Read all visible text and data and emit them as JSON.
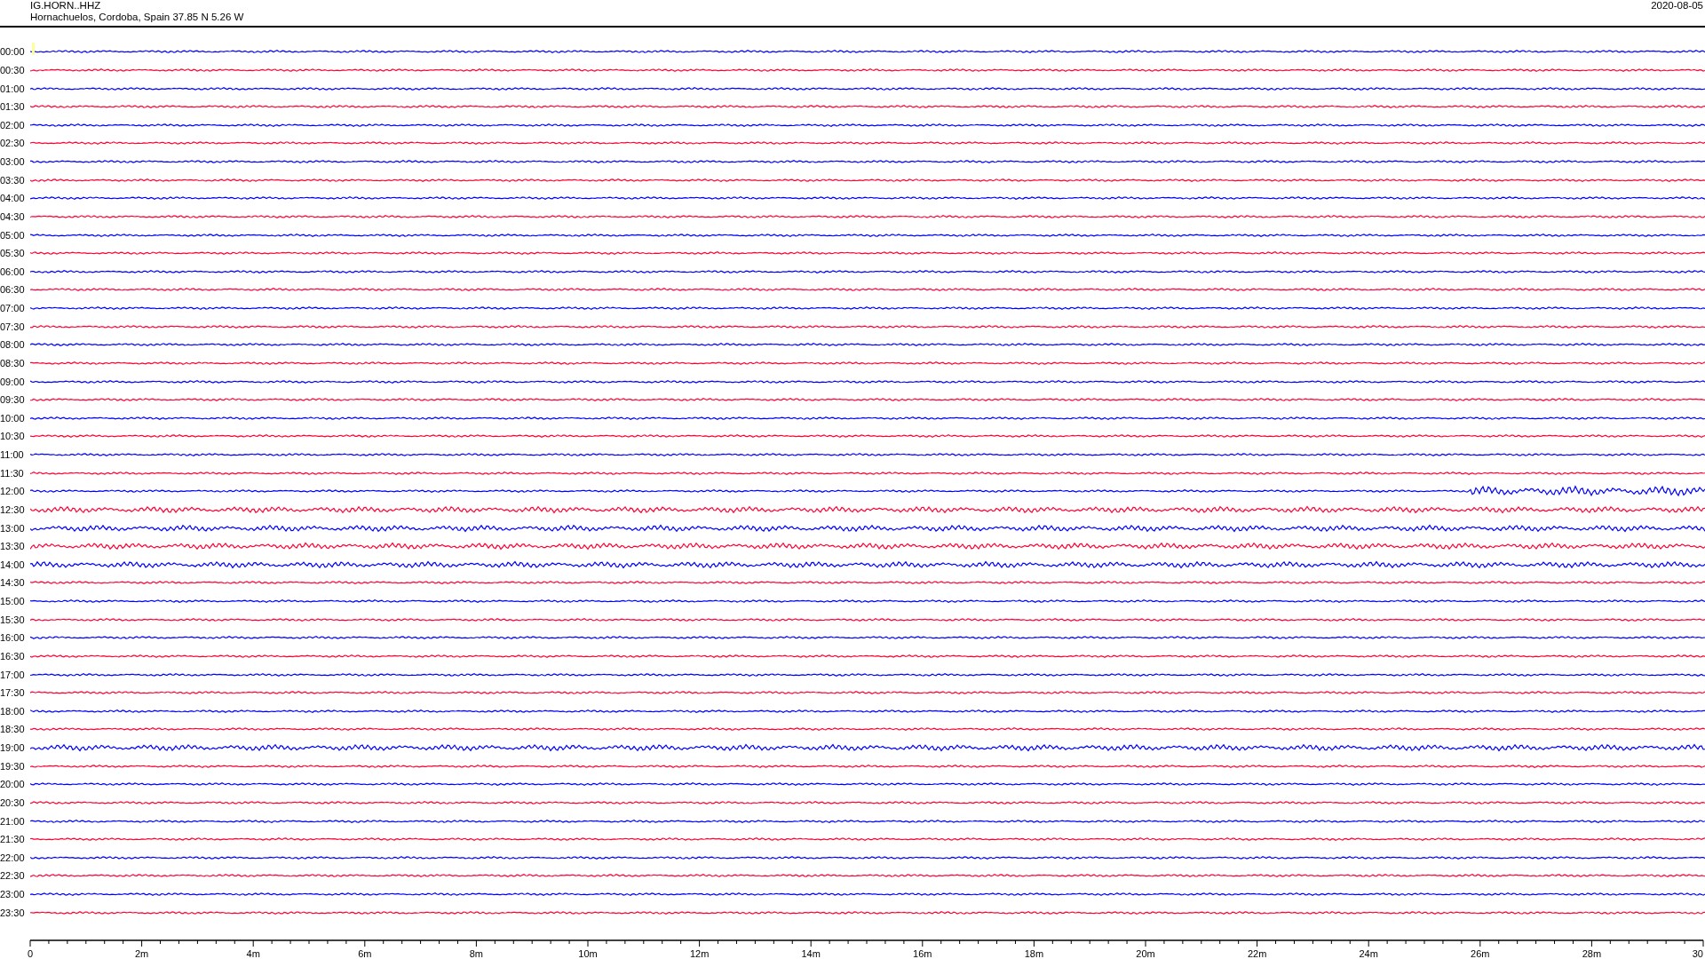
{
  "header": {
    "station": "IG.HORN..HHZ",
    "location": "Hornachuelos, Cordoba, Spain  37.85 N 5.26 W",
    "date": "2020-08-05"
  },
  "traces": [
    {
      "time": "00:00",
      "color": "#0000ff",
      "kind": "quiet"
    },
    {
      "time": "00:30",
      "color": "#ff0033",
      "kind": "quiet"
    },
    {
      "time": "01:00",
      "color": "#0000ff",
      "kind": "quiet"
    },
    {
      "time": "01:30",
      "color": "#ff0033",
      "kind": "quiet"
    },
    {
      "time": "02:00",
      "color": "#0000ff",
      "kind": "quiet"
    },
    {
      "time": "02:30",
      "color": "#ff0033",
      "kind": "quiet"
    },
    {
      "time": "03:00",
      "color": "#0000ff",
      "kind": "quiet"
    },
    {
      "time": "03:30",
      "color": "#ff0033",
      "kind": "quiet"
    },
    {
      "time": "04:00",
      "color": "#0000ff",
      "kind": "quiet"
    },
    {
      "time": "04:30",
      "color": "#ff0033",
      "kind": "quiet"
    },
    {
      "time": "05:00",
      "color": "#0000ff",
      "kind": "quiet"
    },
    {
      "time": "05:30",
      "color": "#ff0033",
      "kind": "quiet"
    },
    {
      "time": "06:00",
      "color": "#0000ff",
      "kind": "quiet"
    },
    {
      "time": "06:30",
      "color": "#ff0033",
      "kind": "quiet"
    },
    {
      "time": "07:00",
      "color": "#0000ff",
      "kind": "quiet"
    },
    {
      "time": "07:30",
      "color": "#ff0033",
      "kind": "quiet"
    },
    {
      "time": "08:00",
      "color": "#0000ff",
      "kind": "quiet"
    },
    {
      "time": "08:30",
      "color": "#ff0033",
      "kind": "quiet"
    },
    {
      "time": "09:00",
      "color": "#0000ff",
      "kind": "quiet"
    },
    {
      "time": "09:30",
      "color": "#ff0033",
      "kind": "quiet"
    },
    {
      "time": "10:00",
      "color": "#0000ff",
      "kind": "quiet"
    },
    {
      "time": "10:30",
      "color": "#ff0033",
      "kind": "quiet"
    },
    {
      "time": "11:00",
      "color": "#0000ff",
      "kind": "quiet"
    },
    {
      "time": "11:30",
      "color": "#ff0033",
      "kind": "quiet"
    },
    {
      "time": "12:00",
      "color": "#0000ff",
      "kind": "event"
    },
    {
      "time": "12:30",
      "color": "#ff0033",
      "kind": "noisy"
    },
    {
      "time": "13:00",
      "color": "#0000ff",
      "kind": "noisy"
    },
    {
      "time": "13:30",
      "color": "#ff0033",
      "kind": "noisy"
    },
    {
      "time": "14:00",
      "color": "#0000ff",
      "kind": "noisy"
    },
    {
      "time": "14:30",
      "color": "#ff0033",
      "kind": "quiet"
    },
    {
      "time": "15:00",
      "color": "#0000ff",
      "kind": "quiet"
    },
    {
      "time": "15:30",
      "color": "#ff0033",
      "kind": "quiet"
    },
    {
      "time": "16:00",
      "color": "#0000ff",
      "kind": "quiet"
    },
    {
      "time": "16:30",
      "color": "#ff0033",
      "kind": "quiet"
    },
    {
      "time": "17:00",
      "color": "#0000ff",
      "kind": "quiet"
    },
    {
      "time": "17:30",
      "color": "#ff0033",
      "kind": "quiet"
    },
    {
      "time": "18:00",
      "color": "#0000ff",
      "kind": "quiet"
    },
    {
      "time": "18:30",
      "color": "#ff0033",
      "kind": "quiet"
    },
    {
      "time": "19:00",
      "color": "#0000ff",
      "kind": "noisy"
    },
    {
      "time": "19:30",
      "color": "#ff0033",
      "kind": "quiet"
    },
    {
      "time": "20:00",
      "color": "#0000ff",
      "kind": "quiet"
    },
    {
      "time": "20:30",
      "color": "#ff0033",
      "kind": "quiet"
    },
    {
      "time": "21:00",
      "color": "#0000ff",
      "kind": "quiet"
    },
    {
      "time": "21:30",
      "color": "#ff0033",
      "kind": "quiet"
    },
    {
      "time": "22:00",
      "color": "#0000ff",
      "kind": "quiet"
    },
    {
      "time": "22:30",
      "color": "#ff0033",
      "kind": "quiet"
    },
    {
      "time": "23:00",
      "color": "#0000ff",
      "kind": "quiet"
    },
    {
      "time": "23:30",
      "color": "#ff0033",
      "kind": "quiet"
    }
  ],
  "x_axis": {
    "ticks": [
      "0",
      "2m",
      "4m",
      "6m",
      "8m",
      "10m",
      "12m",
      "14m",
      "16m",
      "18m",
      "20m",
      "22m",
      "24m",
      "26m",
      "28m",
      "30"
    ]
  }
}
